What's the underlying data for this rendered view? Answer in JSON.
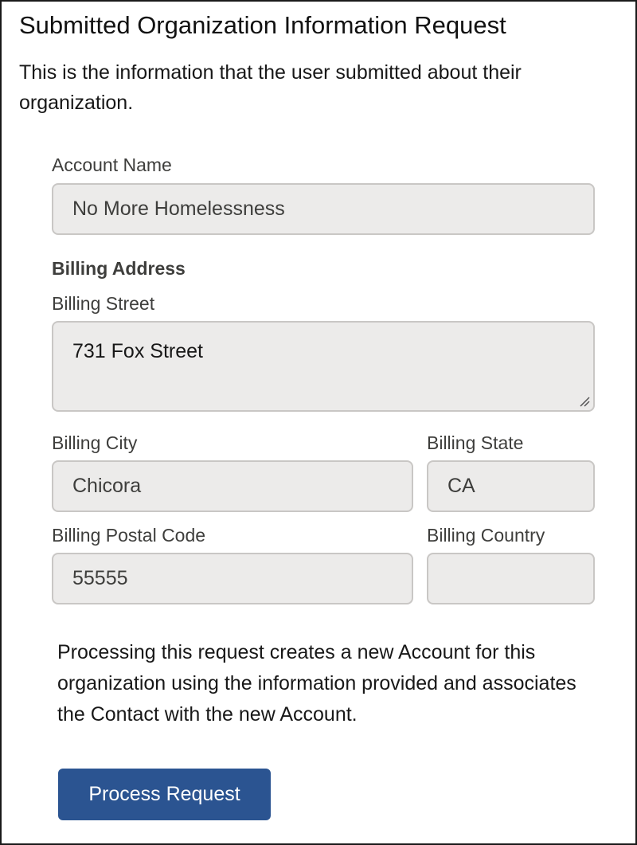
{
  "header": {
    "title": "Submitted Organization Information Request",
    "description": "This is the information that the user submitted about their organization."
  },
  "form": {
    "account_name": {
      "label": "Account Name",
      "value": "No More Homelessness"
    },
    "billing_address_heading": "Billing Address",
    "billing_street": {
      "label": "Billing Street",
      "value": "731 Fox Street"
    },
    "billing_city": {
      "label": "Billing City",
      "value": "Chicora"
    },
    "billing_state": {
      "label": "Billing State",
      "value": "CA"
    },
    "billing_postal_code": {
      "label": "Billing Postal Code",
      "value": "55555"
    },
    "billing_country": {
      "label": "Billing Country",
      "value": ""
    }
  },
  "note": "Processing this request creates a new Account for this organization using the information provided and associates the Contact with the new Account.",
  "actions": {
    "process_label": "Process Request"
  },
  "colors": {
    "button": "#2b5491",
    "field_bg": "#ecebea",
    "field_border": "#c9c7c5"
  }
}
